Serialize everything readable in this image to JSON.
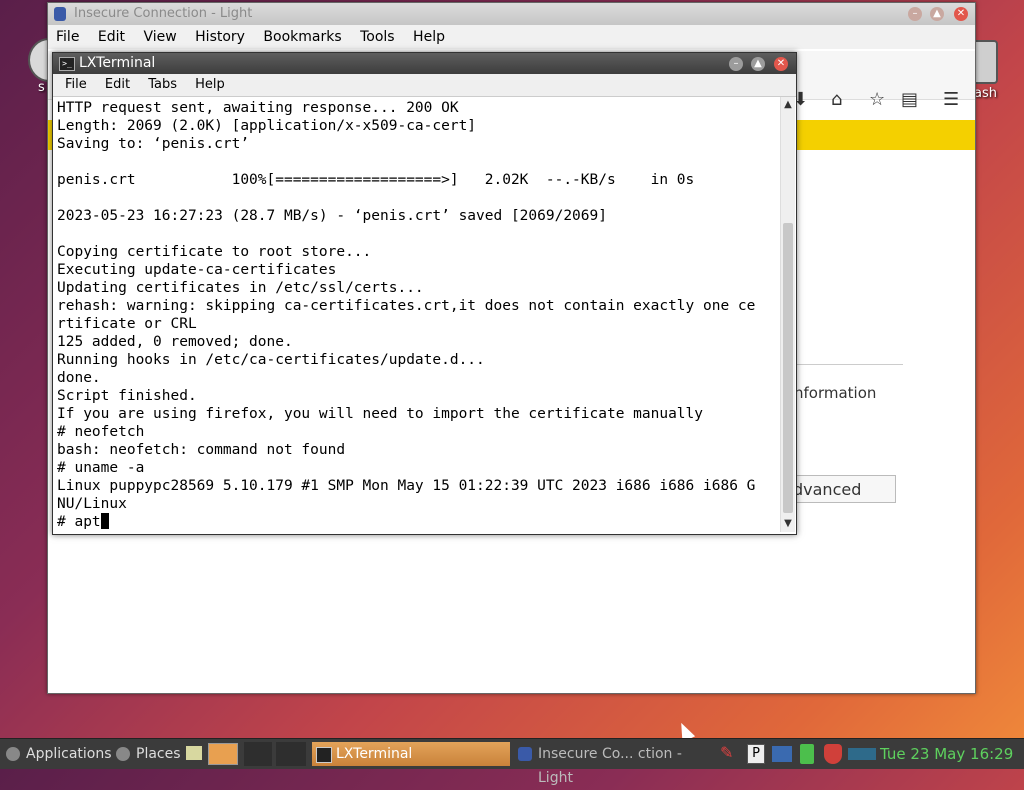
{
  "desktop": {
    "left_icon_label": "s",
    "right_icon_label": "ash"
  },
  "browser": {
    "title": "Insecure Connection - Light",
    "menu": [
      "File",
      "Edit",
      "View",
      "History",
      "Bookmarks",
      "Tools",
      "Help"
    ],
    "info_link_partial": "nformation",
    "advanced_partial": "dvanced"
  },
  "terminal": {
    "title": "LXTerminal",
    "menu": [
      "File",
      "Edit",
      "Tabs",
      "Help"
    ],
    "lines": [
      "HTTP request sent, awaiting response... 200 OK",
      "Length: 2069 (2.0K) [application/x-x509-ca-cert]",
      "Saving to: ‘penis.crt’",
      "",
      "penis.crt           100%[===================>]   2.02K  --.-KB/s    in 0s",
      "",
      "2023-05-23 16:27:23 (28.7 MB/s) - ‘penis.crt’ saved [2069/2069]",
      "",
      "Copying certificate to root store...",
      "Executing update-ca-certificates",
      "Updating certificates in /etc/ssl/certs...",
      "rehash: warning: skipping ca-certificates.crt,it does not contain exactly one ce",
      "rtificate or CRL",
      "125 added, 0 removed; done.",
      "Running hooks in /etc/ca-certificates/update.d...",
      "done.",
      "Script finished.",
      "If you are using firefox, you will need to import the certificate manually",
      "# neofetch",
      "bash: neofetch: command not found",
      "# uname -a",
      "Linux puppypc28569 5.10.179 #1 SMP Mon May 15 01:22:39 UTC 2023 i686 i686 i686 G",
      "NU/Linux"
    ],
    "prompt": "# apt"
  },
  "taskbar": {
    "applications": "Applications",
    "places": "Places",
    "task_terminal": "LXTerminal",
    "task_browser": "Insecure Co... ction - Light",
    "clock": "Tue 23 May 16:29"
  }
}
